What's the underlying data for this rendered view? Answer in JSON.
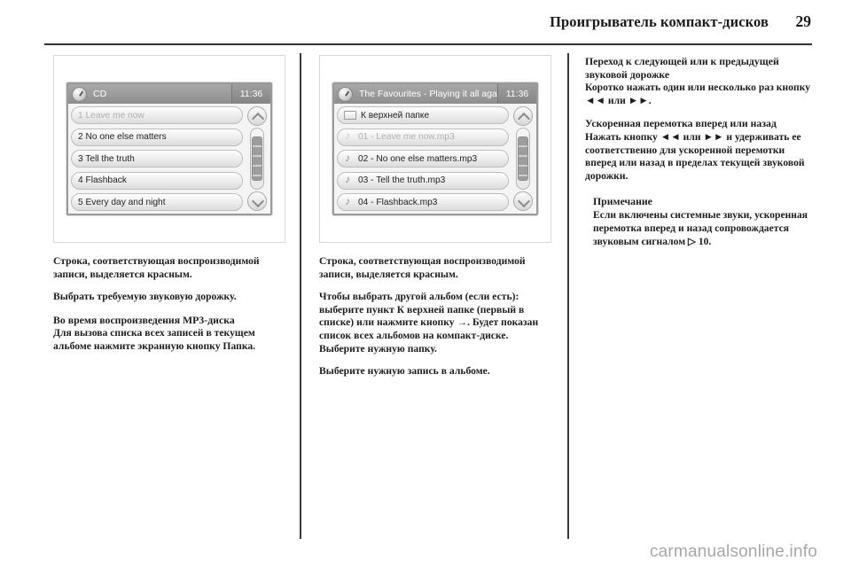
{
  "header": {
    "title": "Проигрыватель компакт-дисков",
    "page_number": "29"
  },
  "figures": [
    {
      "name": "cd-track-list",
      "titlebar_icon": "clock-icon",
      "title": "CD",
      "clock": "11:36",
      "rows": [
        {
          "label": "1 Leave me now",
          "dim": true,
          "icon": "none"
        },
        {
          "label": "2 No one else matters",
          "dim": false,
          "icon": "none"
        },
        {
          "label": "3 Tell the truth",
          "dim": false,
          "icon": "none"
        },
        {
          "label": "4 Flashback",
          "dim": false,
          "icon": "none"
        },
        {
          "label": "5 Every day and night",
          "dim": false,
          "icon": "none"
        }
      ],
      "scroll_up": "scroll-up-icon",
      "scroll_down": "scroll-down-icon"
    },
    {
      "name": "mp3-folder-list",
      "titlebar_icon": "clock-icon",
      "title": "The Favourites - Playing it all again",
      "clock": "11:36",
      "rows": [
        {
          "label": "К верхней папке",
          "dim": false,
          "icon": "folder"
        },
        {
          "label": "01 - Leave me now.mp3",
          "dim": true,
          "icon": "note"
        },
        {
          "label": "02 - No one else matters.mp3",
          "dim": false,
          "icon": "note"
        },
        {
          "label": "03 - Tell the truth.mp3",
          "dim": false,
          "icon": "note"
        },
        {
          "label": "04 - Flashback.mp3",
          "dim": false,
          "icon": "note"
        }
      ],
      "scroll_up": "scroll-up-icon",
      "scroll_down": "scroll-down-icon"
    }
  ],
  "column1": {
    "p1": "Строка, соответствующая воспроизводимой записи, выделяется красным.",
    "p2": "Выбрать требуемую звуковую дорожку.",
    "head1": "Во время воспроизведения MP3-диска",
    "p3": "Для вызова списка всех записей в текущем альбоме нажмите экранную кнопку Папка."
  },
  "column2": {
    "p1": "Строка, соответствующая воспроизводимой записи, выделяется красным.",
    "p2": "Чтобы выбрать другой альбом (если есть): выберите пункт К верхней папке (первый в списке) или нажмите кнопку →. Будет показан список всех альбомов на компакт-диске. Выберите нужную папку.",
    "p3": "Выберите нужную запись в альбоме."
  },
  "column3": {
    "head1": "Переход к следующей или к предыдущей звуковой дорожке",
    "p1": "Коротко нажать один или несколько раз кнопку ◄◄ или ►►.",
    "head2": "Ускоренная перемотка вперед или назад",
    "p2": "Нажать кнопку ◄◄ или ►► и удерживать ее соответственно для ускоренной перемотки вперед или назад в пределах текущей звуковой дорожки.",
    "note_title": "Примечание",
    "note_body": "Если включены системные звуки, ускоренная перемотка вперед и назад сопровождается звуковым сигналом ▷ 10."
  },
  "footer": {
    "watermark": "carmanualsonline.info"
  }
}
